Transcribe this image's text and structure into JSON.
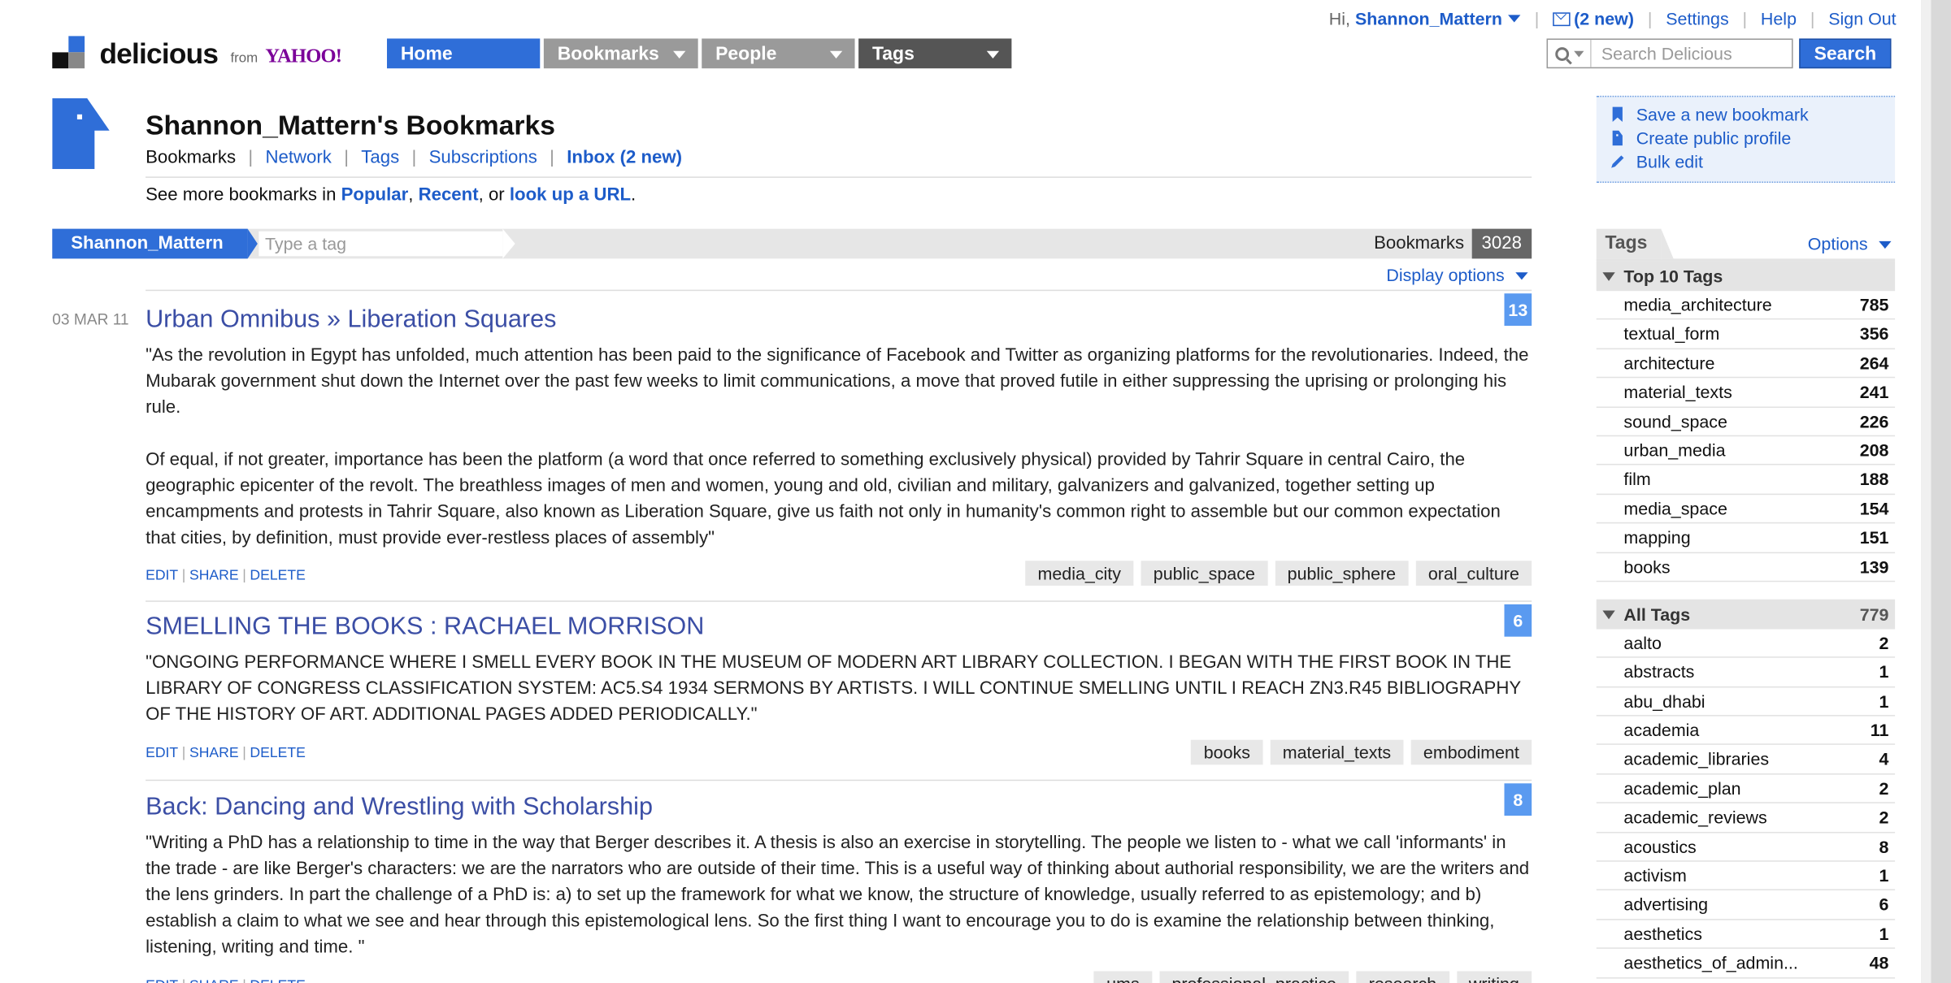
{
  "topbar": {
    "greeting": "Hi,",
    "username": "Shannon_Mattern",
    "inbox": "(2 new)",
    "settings": "Settings",
    "help": "Help",
    "signout": "Sign Out"
  },
  "logo": {
    "word": "delicious",
    "from": "from",
    "yahoo": "YAHOO!"
  },
  "nav": {
    "home": "Home",
    "bookmarks": "Bookmarks",
    "people": "People",
    "tags": "Tags"
  },
  "search": {
    "placeholder": "Search Delicious",
    "button": "Search"
  },
  "header": {
    "title": "Shannon_Mattern's Bookmarks",
    "subnav": [
      "Bookmarks",
      "Network",
      "Tags",
      "Subscriptions",
      "Inbox (2 new)"
    ],
    "seemore_prefix": "See more bookmarks in",
    "popular": "Popular",
    "recent": "Recent",
    "or": ", or",
    "lookup": "look up a URL"
  },
  "filter": {
    "user": "Shannon_Mattern",
    "tag_placeholder": "Type a tag",
    "bookmarks_label": "Bookmarks",
    "bookmarks_count": "3028",
    "display_options": "Display options"
  },
  "bookmarks": [
    {
      "date": "03 MAR 11",
      "title": "Urban Omnibus » Liberation Squares",
      "count": "13",
      "note_paragraphs": [
        "\"As the revolution in Egypt has unfolded, much attention has been paid to the significance of Facebook and Twitter as organizing platforms for the revolutionaries. Indeed, the Mubarak government shut down the Internet over the past few weeks to limit communications, a move that proved futile in either suppressing the uprising or prolonging his rule.",
        "Of equal, if not greater, importance has been the platform (a word that once referred to something exclusively physical) provided by Tahrir Square in central Cairo, the geographic epicenter of the revolt. The breathless images of men and women, young and old, civilian and military, galvanizers and galvanized, together setting up encampments and protests in Tahrir Square, also known as Liberation Square, give us faith not only in humanity's common right to assemble but our common expectation that cities, by definition, must provide ever-restless places of assembly\""
      ],
      "tags": [
        "media_city",
        "public_space",
        "public_sphere",
        "oral_culture"
      ]
    },
    {
      "date": "",
      "title": "SMELLING THE BOOKS : RACHAEL MORRISON",
      "count": "6",
      "note_paragraphs": [
        "\"ONGOING PERFORMANCE WHERE I SMELL EVERY BOOK IN THE MUSEUM OF MODERN ART LIBRARY COLLECTION. I BEGAN WITH THE FIRST BOOK IN THE LIBRARY OF CONGRESS CLASSIFICATION SYSTEM: AC5.S4 1934 SERMONS BY ARTISTS. I WILL CONTINUE SMELLING UNTIL I REACH ZN3.R45 BIBLIOGRAPHY OF THE HISTORY OF ART. ADDITIONAL PAGES ADDED PERIODICALLY.\""
      ],
      "tags": [
        "books",
        "material_texts",
        "embodiment"
      ]
    },
    {
      "date": "",
      "title": "Back: Dancing and Wrestling with Scholarship",
      "count": "8",
      "note_paragraphs": [
        "\"Writing a PhD has a relationship to time in the way that Berger describes it. A thesis is also an exercise in storytelling. The people we listen to - what we call 'informants' in the trade - are like Berger's characters: we are the narrators who are outside of their time. This is a useful way of thinking about authorial responsibility, we are the writers and the lens grinders. In part the challenge of a PhD is: a) to set up the framework for what we know, the structure of knowledge, usually referred to as epistemology; and b) establish a claim to what we see and hear through this epistemological lens. So the first thing I want to encourage you to do is examine the relationship between thinking, listening, writing and time. \""
      ],
      "tags": [
        "ums",
        "professional_practice",
        "research",
        "writing"
      ]
    }
  ],
  "actions": {
    "edit": "EDIT",
    "share": "SHARE",
    "delete": "DELETE"
  },
  "sidebar_actions": [
    "Save a new bookmark",
    "Create public profile",
    "Bulk edit"
  ],
  "tags_panel": {
    "title": "Tags",
    "options": "Options",
    "top10_label": "Top 10 Tags",
    "top10": [
      {
        "name": "media_architecture",
        "count": "785"
      },
      {
        "name": "textual_form",
        "count": "356"
      },
      {
        "name": "architecture",
        "count": "264"
      },
      {
        "name": "material_texts",
        "count": "241"
      },
      {
        "name": "sound_space",
        "count": "226"
      },
      {
        "name": "urban_media",
        "count": "208"
      },
      {
        "name": "film",
        "count": "188"
      },
      {
        "name": "media_space",
        "count": "154"
      },
      {
        "name": "mapping",
        "count": "151"
      },
      {
        "name": "books",
        "count": "139"
      }
    ],
    "all_label": "All Tags",
    "all_count": "779",
    "all": [
      {
        "name": "aalto",
        "count": "2"
      },
      {
        "name": "abstracts",
        "count": "1"
      },
      {
        "name": "abu_dhabi",
        "count": "1"
      },
      {
        "name": "academia",
        "count": "11"
      },
      {
        "name": "academic_libraries",
        "count": "4"
      },
      {
        "name": "academic_plan",
        "count": "2"
      },
      {
        "name": "academic_reviews",
        "count": "2"
      },
      {
        "name": "acoustics",
        "count": "8"
      },
      {
        "name": "activism",
        "count": "1"
      },
      {
        "name": "advertising",
        "count": "6"
      },
      {
        "name": "aesthetics",
        "count": "1"
      },
      {
        "name": "aesthetics_of_admin...",
        "count": "48"
      }
    ]
  },
  "colors": {
    "brand_blue": "#2f6ed8",
    "link": "#1d5cc9",
    "title_link": "#3b4ea5",
    "badge": "#5a9af0",
    "nav_gray": "#9a9a9a",
    "nav_dark": "#555555"
  }
}
